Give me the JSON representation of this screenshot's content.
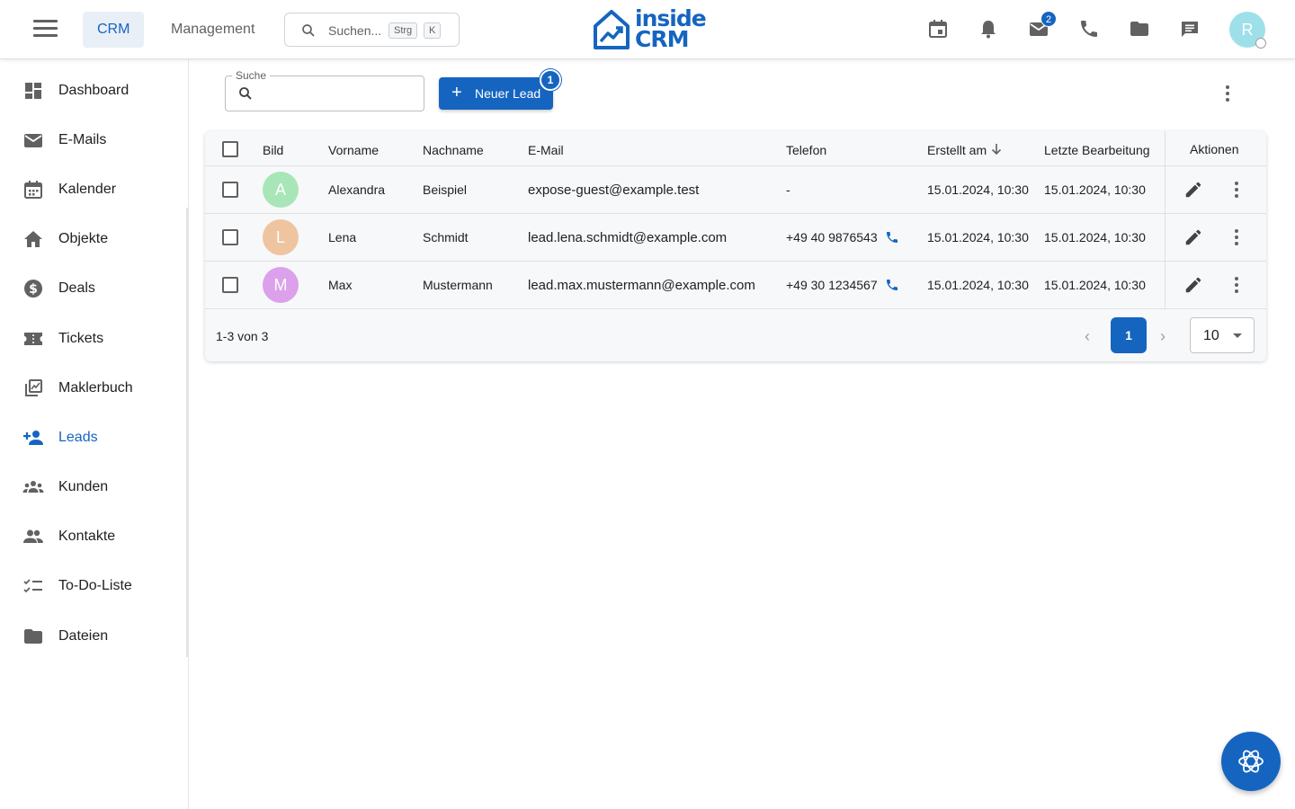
{
  "colors": {
    "accent": "#1565c0",
    "avatar_a": "#a8e6b8",
    "avatar_l": "#efc4a0",
    "avatar_m": "#dca1ea",
    "avatar_user": "#9ee0ea"
  },
  "header": {
    "tabs": [
      {
        "label": "CRM",
        "active": true
      },
      {
        "label": "Management",
        "active": false
      }
    ],
    "search": {
      "placeholder": "Suchen...",
      "kbd_1": "Strg",
      "kbd_2": "K"
    },
    "logo": {
      "line1": "inside",
      "line2": "CRM"
    },
    "mail_badge": "2",
    "avatar_initial": "R",
    "icons": [
      "calendar-icon",
      "bell-icon",
      "mail-icon",
      "phone-icon",
      "folder-icon",
      "chat-icon"
    ]
  },
  "sidebar": {
    "items": [
      {
        "label": "Dashboard",
        "icon": "dashboard-icon"
      },
      {
        "label": "E-Mails",
        "icon": "mail-icon"
      },
      {
        "label": "Kalender",
        "icon": "calendar-icon"
      },
      {
        "label": "Objekte",
        "icon": "house-icon"
      },
      {
        "label": "Deals",
        "icon": "dollar-icon"
      },
      {
        "label": "Tickets",
        "icon": "ticket-icon"
      },
      {
        "label": "Maklerbuch",
        "icon": "library-icon"
      },
      {
        "label": "Leads",
        "icon": "person-add-icon",
        "active": true
      },
      {
        "label": "Kunden",
        "icon": "groups-icon"
      },
      {
        "label": "Kontakte",
        "icon": "people-icon"
      },
      {
        "label": "To-Do-Liste",
        "icon": "checklist-icon"
      },
      {
        "label": "Dateien",
        "icon": "folder-icon"
      }
    ]
  },
  "toolbar": {
    "search_label": "Suche",
    "new_lead_label": "Neuer Lead",
    "tour_badge": "1"
  },
  "table": {
    "columns": [
      "Bild",
      "Vorname",
      "Nachname",
      "E-Mail",
      "Telefon",
      "Erstellt am",
      "Letzte Bearbeitung",
      "Aktionen"
    ],
    "sort_column": "Erstellt am",
    "sort_direction": "desc",
    "rows": [
      {
        "initial": "A",
        "vorname": "Alexandra",
        "nachname": "Beispiel",
        "email": "expose-guest@example.test",
        "telefon": "-",
        "erstellt": "15.01.2024, 10:30",
        "bearbeitet": "15.01.2024, 10:30"
      },
      {
        "initial": "L",
        "vorname": "Lena",
        "nachname": "Schmidt",
        "email": "lead.lena.schmidt@example.com",
        "telefon": "+49 40 9876543",
        "erstellt": "15.01.2024, 10:30",
        "bearbeitet": "15.01.2024, 10:30"
      },
      {
        "initial": "M",
        "vorname": "Max",
        "nachname": "Mustermann",
        "email": "lead.max.mustermann@example.com",
        "telefon": "+49 30 1234567",
        "erstellt": "15.01.2024, 10:30",
        "bearbeitet": "15.01.2024, 10:30"
      }
    ]
  },
  "pagination": {
    "range_text": "1-3 von 3",
    "current_page": "1",
    "per_page": "10"
  }
}
